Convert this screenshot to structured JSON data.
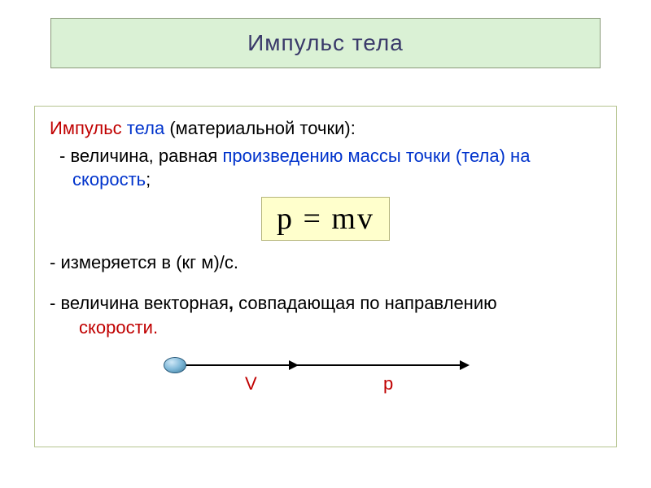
{
  "title": "Импульс тела",
  "def_term_red": "Импульс",
  "def_term_blue": " тела ",
  "def_paren": "(материальной точки):",
  "bullet_dash": "-  ",
  "bullet_lead": "величина, равная ",
  "bullet_blue": "произведению массы точки (тела) на скорость",
  "bullet_semi": ";",
  "formula": "p = mv",
  "units": "- измеряется в (кг м)/с.",
  "vector_part1": "- величина векторная",
  "vector_bold_comma": ",",
  "vector_part2": " совпадающая по направлению ",
  "vector_red": "скорости.",
  "label_v": "V",
  "label_p": "p"
}
